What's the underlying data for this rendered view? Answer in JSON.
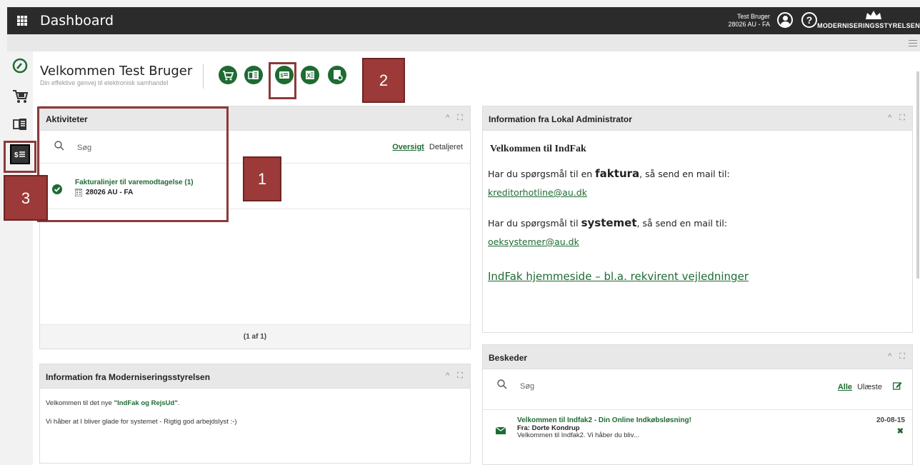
{
  "topbar": {
    "title": "Dashboard",
    "user_name": "Test Bruger",
    "user_unit": "28026 AU - FA",
    "brand": "MODERNISERINGSSTYRELSEN"
  },
  "leftnav": {
    "items": [
      "dashboard-icon",
      "cart-icon",
      "invoice-icon",
      "payment-icon"
    ]
  },
  "welcome": {
    "title": "Velkommen Test Bruger",
    "subtitle": "Din effektive genvej til elektronisk samhandel"
  },
  "quick_actions": [
    "cart-icon",
    "invoice-icon",
    "payment-icon",
    "excel-icon",
    "document-icon"
  ],
  "activities": {
    "title": "Aktiviteter",
    "search_placeholder": "Søg",
    "view_overview": "Oversigt",
    "view_detail": "Detaljeret",
    "items": [
      {
        "title": "Fakturalinjer til varemodtagelse (1)",
        "unit": "28026 AU - FA"
      }
    ],
    "pager": "(1 af 1)"
  },
  "admin_info": {
    "title": "Information fra Lokal Administrator",
    "welcome": "Velkommen til IndFak",
    "line1_pre": "Har du spørgsmål til en ",
    "line1_bold": "faktura",
    "line1_post": ", så send en mail til:",
    "email1": "kreditorhotline@au.dk",
    "line2_pre": "Har du spørgsmål til ",
    "line2_bold": "systemet",
    "line2_post": ", så send en mail til:",
    "email2": "oeksystemer@au.dk",
    "homepage_link": "IndFak hjemmeside – bl.a. rekvirent vejledninger"
  },
  "modst_info": {
    "title": "Information fra Moderniseringsstyrelsen",
    "line1_pre": "Velkommen til det nye ",
    "line1_quote": "\"IndFak og RejsUd\"",
    "line1_post": ".",
    "line2": "Vi håber at I bliver glade for systemet - Rigtig god arbejdslyst :-)"
  },
  "messages": {
    "title": "Beskeder",
    "search_placeholder": "Søg",
    "filter_all": "Alle",
    "filter_unread": "Ulæste",
    "items": [
      {
        "subject": "Velkommen til Indfak2 - Din Online Indkøbsløsning!",
        "from": "Fra: Dorte Kondrup",
        "preview": "Velkommen til Indfak2. Vi håber du bliv...",
        "date": "20-08-15"
      }
    ]
  },
  "annotations": [
    "1",
    "2",
    "3"
  ],
  "colors": {
    "green": "#1e6b33",
    "topbar": "#2b2b2b",
    "annotation": "#9b3a38"
  }
}
